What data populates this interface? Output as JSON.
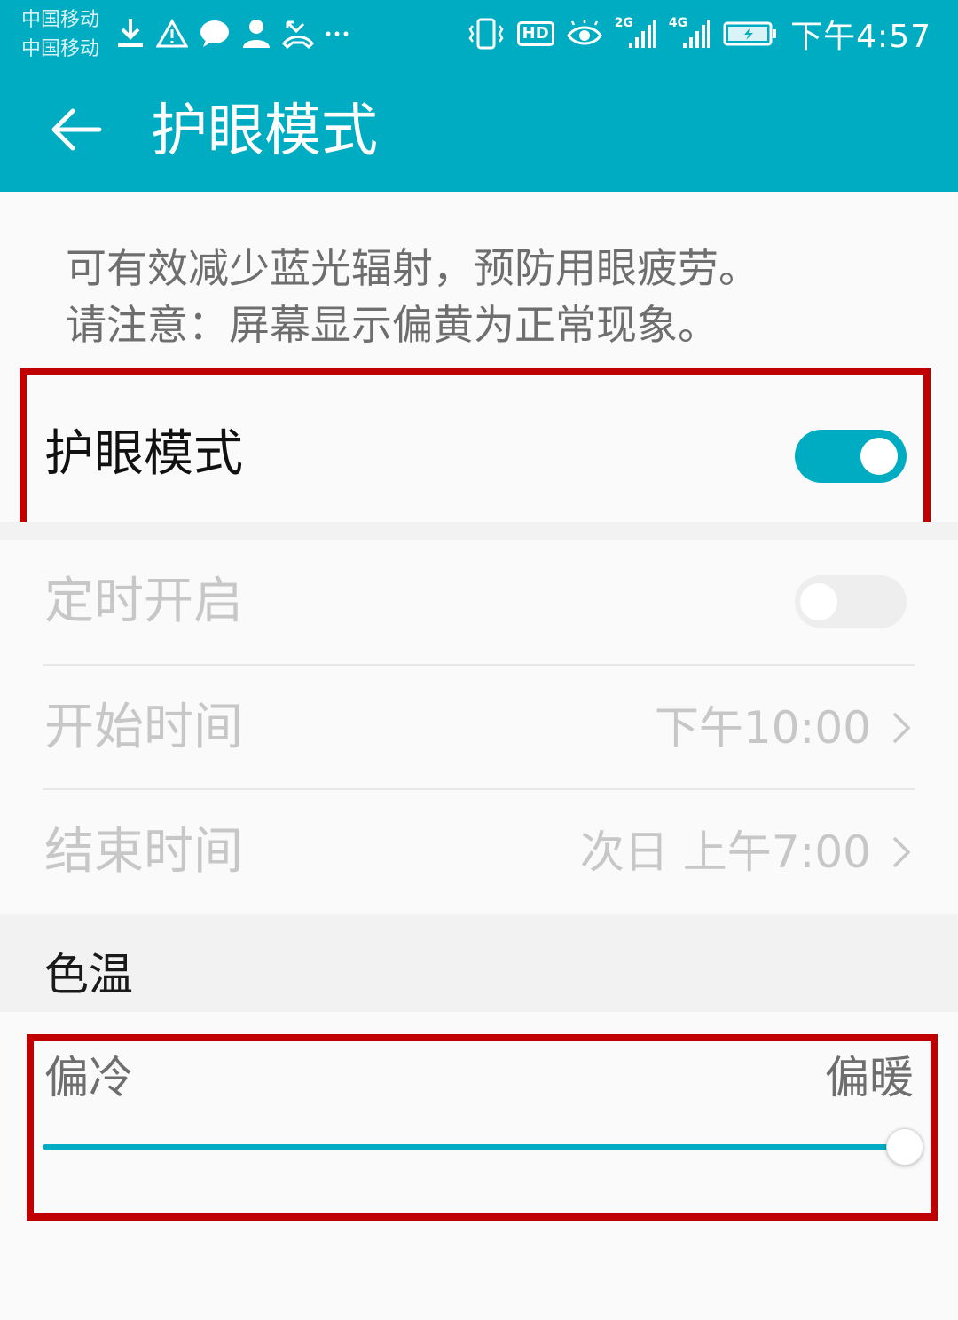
{
  "status_bar": {
    "carrier_1": "中国移动",
    "carrier_2": "中国移动",
    "left_icons": [
      "download-icon",
      "warning-icon",
      "message-icon",
      "person-icon",
      "missed-call-icon",
      "more-dots-icon"
    ],
    "hd_label": "HD",
    "network_1": "2G",
    "network_2": "4G",
    "time": "下午4:57"
  },
  "app_bar": {
    "back_icon": "arrow-left-icon",
    "title": "护眼模式"
  },
  "description": {
    "line_1": "可有效减少蓝光辐射，预防用眼疲劳。",
    "line_2": "请注意：屏幕显示偏黄为正常现象。"
  },
  "eye_comfort": {
    "label": "护眼模式",
    "enabled": true
  },
  "schedule": {
    "label": "定时开启",
    "enabled": false,
    "start_label": "开始时间",
    "start_value": "下午10:00",
    "end_label": "结束时间",
    "end_value": "次日 上午7:00"
  },
  "color_temperature": {
    "section_title": "色温",
    "cold_label": "偏冷",
    "warm_label": "偏暖",
    "level": 1.0
  },
  "colors": {
    "accent": "#00acc1",
    "highlight": "#c00000",
    "disabled_text": "#c7c7c7"
  }
}
